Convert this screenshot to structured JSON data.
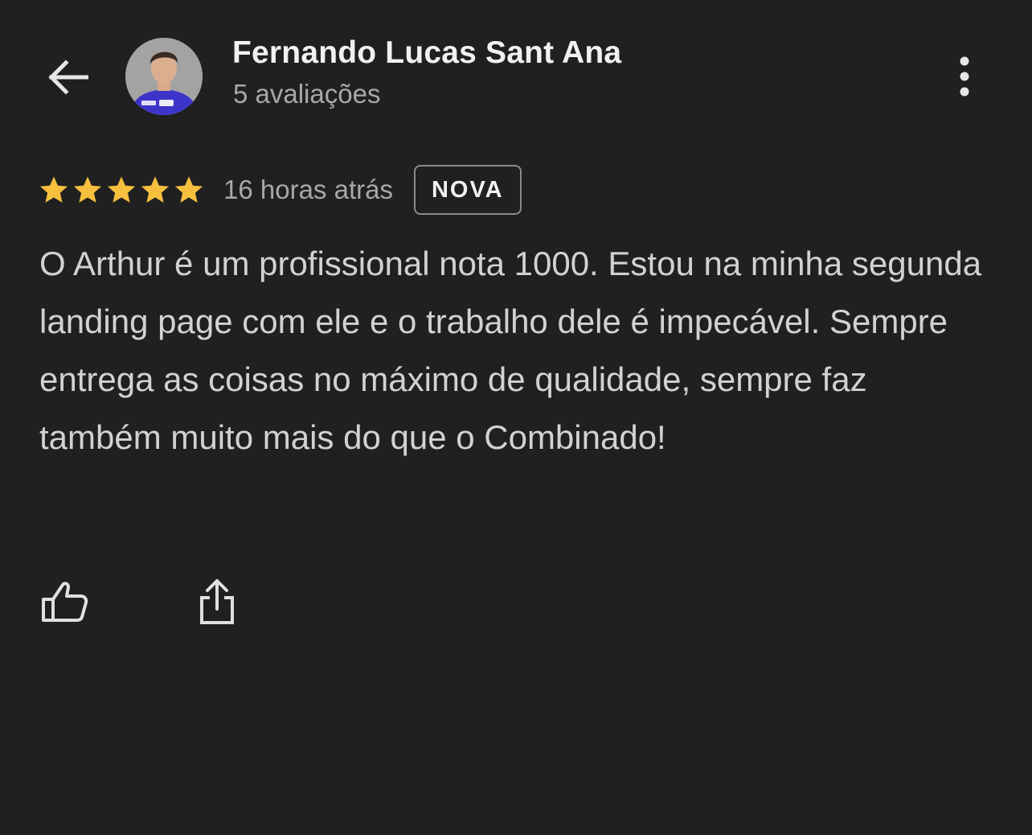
{
  "header": {
    "back_icon": "arrow-left-icon",
    "reviewer_name": "Fernando Lucas Sant Ana",
    "review_count": "5 avaliações",
    "more_icon": "more-vertical-icon"
  },
  "review": {
    "rating": 5,
    "rating_max": 5,
    "time_ago": "16 horas atrás",
    "badge": "NOVA",
    "text": "O Arthur é um profissional nota 1000. Estou na minha segunda landing page com ele e o trabalho dele é impecável. Sempre entrega as coisas no máximo de qualidade, sempre faz também muito mais do que o Combinado!"
  },
  "actions": {
    "like_icon": "thumbs-up-icon",
    "share_icon": "share-icon"
  },
  "colors": {
    "background": "#202020",
    "star": "#f6bf3e",
    "primary_text": "#f1f1f1",
    "secondary_text": "#a8a8a8",
    "body_text": "#d2d2d2"
  }
}
